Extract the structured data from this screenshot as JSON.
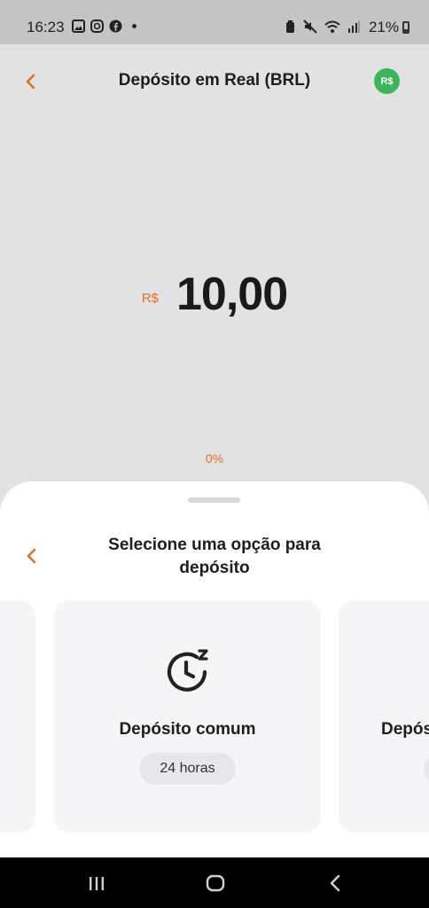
{
  "status_bar": {
    "time": "16:23",
    "battery_percent": "21%",
    "left_icons": [
      "image-icon",
      "instagram-icon",
      "facebook-icon",
      "dot-icon"
    ],
    "right_icons": [
      "alarm-icon",
      "mute-icon",
      "wifi-icon",
      "signal-icon",
      "battery-icon"
    ]
  },
  "header": {
    "title": "Depósito em Real (BRL)",
    "currency_badge": "R$",
    "badge_color": "#3cb55a"
  },
  "amount": {
    "currency": "R$",
    "value": "10,00",
    "progress_label": "0%"
  },
  "sheet": {
    "title": "Selecione uma opção para depósito",
    "cards": [
      {
        "title": "Depósito comum",
        "duration": "24 horas",
        "icon": "clock-snooze-icon"
      },
      {
        "title": "Depós",
        "duration": ""
      }
    ]
  },
  "nav": {
    "buttons": [
      "recent-apps-icon",
      "home-icon",
      "back-icon"
    ]
  },
  "colors": {
    "accent": "#e07020",
    "background": "#e2e2e2",
    "sheet": "#ffffff"
  }
}
